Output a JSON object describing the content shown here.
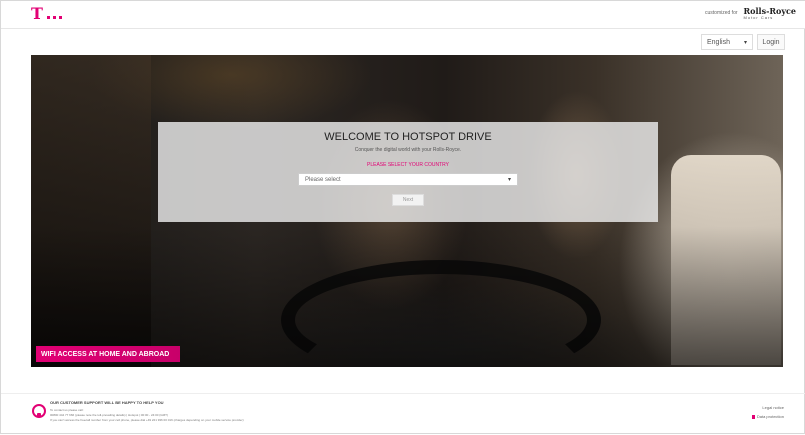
{
  "header": {
    "logo_letter": "T",
    "customized_by": "customized for",
    "brand_name": "Rolls-Royce",
    "brand_sub": "Motor Cars"
  },
  "toolbar": {
    "language": "English",
    "login_label": "Login"
  },
  "welcome": {
    "title": "WELCOME TO HOTSPOT DRIVE",
    "subtitle": "Conquer the digital world with your Rolls-Royce.",
    "prompt": "PLEASE SELECT YOUR COUNTRY",
    "select_value": "Please select",
    "next_label": "Next"
  },
  "hero": {
    "badge": "WIFI ACCESS AT HOME AND ABROAD"
  },
  "footer": {
    "support_title": "OUR CUSTOMER SUPPORT WILL BE HAPPY TO HELP YOU",
    "line1": "To contact us please call:",
    "line2": "00800 444 77 666 (please note the toll-prevailing details) | Hotspot | 00:00 - 24:00 (GMT)",
    "line3": "If you can't access the freecall number from your cell phone, please dial +49 221 936 00 016 (charges depending on your mobile service provider)",
    "legal_notice": "Legal notice",
    "data_protection": "Data protection"
  },
  "colors": {
    "accent": "#e20074"
  },
  "icons": {
    "chevron": "chevron-down-icon",
    "support": "headset-icon",
    "lock": "lock-icon"
  }
}
